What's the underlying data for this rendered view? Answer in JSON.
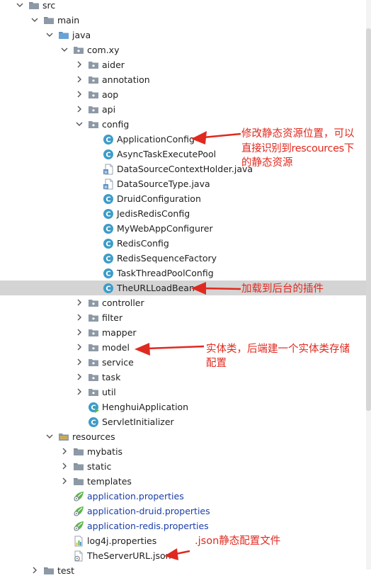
{
  "tree": {
    "items": [
      {
        "label": "src",
        "depth": 0,
        "expanded": true,
        "icon": "folder-icon"
      },
      {
        "label": "main",
        "depth": 1,
        "expanded": true,
        "icon": "folder-icon"
      },
      {
        "label": "java",
        "depth": 2,
        "expanded": true,
        "icon": "source-folder-icon"
      },
      {
        "label": "com.xy",
        "depth": 3,
        "expanded": true,
        "icon": "package-icon"
      },
      {
        "label": "aider",
        "depth": 4,
        "expanded": false,
        "icon": "package-icon"
      },
      {
        "label": "annotation",
        "depth": 4,
        "expanded": false,
        "icon": "package-icon"
      },
      {
        "label": "aop",
        "depth": 4,
        "expanded": false,
        "icon": "package-icon"
      },
      {
        "label": "api",
        "depth": 4,
        "expanded": false,
        "icon": "package-icon"
      },
      {
        "label": "config",
        "depth": 4,
        "expanded": true,
        "icon": "package-icon"
      },
      {
        "label": "ApplicationConfig",
        "depth": 5,
        "icon": "java-class-icon"
      },
      {
        "label": "AsyncTaskExecutePool",
        "depth": 5,
        "icon": "java-class-icon"
      },
      {
        "label": "DataSourceContextHolder.java",
        "depth": 5,
        "icon": "java-file-icon"
      },
      {
        "label": "DataSourceType.java",
        "depth": 5,
        "icon": "java-file-icon"
      },
      {
        "label": "DruidConfiguration",
        "depth": 5,
        "icon": "java-class-icon"
      },
      {
        "label": "JedisRedisConfig",
        "depth": 5,
        "icon": "java-class-icon"
      },
      {
        "label": "MyWebAppConfigurer",
        "depth": 5,
        "icon": "java-class-icon"
      },
      {
        "label": "RedisConfig",
        "depth": 5,
        "icon": "java-class-icon"
      },
      {
        "label": "RedisSequenceFactory",
        "depth": 5,
        "icon": "java-class-icon"
      },
      {
        "label": "TaskThreadPoolConfig",
        "depth": 5,
        "icon": "java-class-icon"
      },
      {
        "label": "TheURLLoadBean",
        "depth": 5,
        "icon": "java-class-icon",
        "selected": true
      },
      {
        "label": "controller",
        "depth": 4,
        "expanded": false,
        "icon": "package-icon"
      },
      {
        "label": "filter",
        "depth": 4,
        "expanded": false,
        "icon": "package-icon"
      },
      {
        "label": "mapper",
        "depth": 4,
        "expanded": false,
        "icon": "package-icon"
      },
      {
        "label": "model",
        "depth": 4,
        "expanded": false,
        "icon": "package-icon"
      },
      {
        "label": "service",
        "depth": 4,
        "expanded": false,
        "icon": "package-icon"
      },
      {
        "label": "task",
        "depth": 4,
        "expanded": false,
        "icon": "package-icon"
      },
      {
        "label": "util",
        "depth": 4,
        "expanded": false,
        "icon": "package-icon"
      },
      {
        "label": "HenghuiApplication",
        "depth": 4,
        "icon": "spring-boot-class-icon"
      },
      {
        "label": "ServletInitializer",
        "depth": 4,
        "icon": "java-class-icon"
      },
      {
        "label": "resources",
        "depth": 2,
        "expanded": true,
        "icon": "resources-folder-icon"
      },
      {
        "label": "mybatis",
        "depth": 3,
        "expanded": false,
        "icon": "folder-icon"
      },
      {
        "label": "static",
        "depth": 3,
        "expanded": false,
        "icon": "folder-icon"
      },
      {
        "label": "templates",
        "depth": 3,
        "expanded": false,
        "icon": "folder-icon"
      },
      {
        "label": "application.properties",
        "depth": 3,
        "icon": "spring-properties-icon",
        "blue": true
      },
      {
        "label": "application-druid.properties",
        "depth": 3,
        "icon": "spring-properties-icon",
        "blue": true
      },
      {
        "label": "application-redis.properties",
        "depth": 3,
        "icon": "spring-properties-icon",
        "blue": true
      },
      {
        "label": "log4j.properties",
        "depth": 3,
        "icon": "properties-file-icon"
      },
      {
        "label": "TheServerURL.json",
        "depth": 3,
        "icon": "json-file-icon"
      },
      {
        "label": "test",
        "depth": 1,
        "expanded": false,
        "icon": "folder-icon"
      }
    ]
  },
  "annotations": {
    "config_note_line1": "修改静态资源位置，可以",
    "config_note_line2": "直接识别到rescources下",
    "config_note_line3": "的静态资源",
    "bean_note": "加载到后台的插件",
    "model_note_line1": "实体类，后端建一个实体类存储",
    "model_note_line2": "配置",
    "json_note": ".json静态配置文件"
  },
  "colors": {
    "annotation_red": "#e0291f",
    "selection_gray": "#d4d4d4",
    "folder_gray": "#8d99a6",
    "source_blue": "#6aa2d6",
    "class_teal": "#3e9cc8",
    "spring_green": "#5bb74a",
    "link_blue": "#1a3ea8"
  }
}
